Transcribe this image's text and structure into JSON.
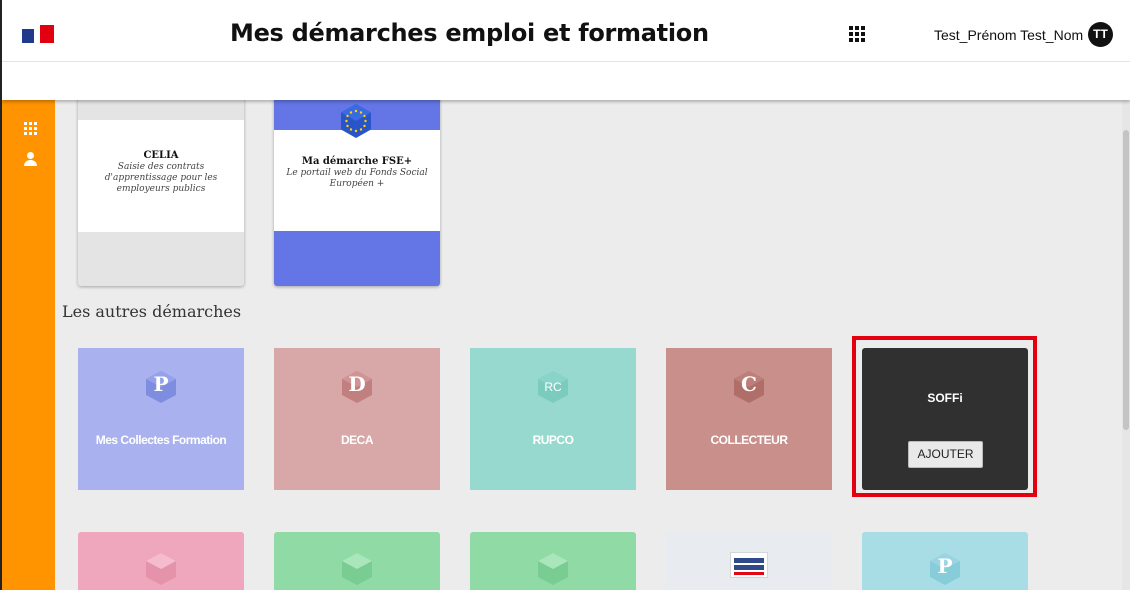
{
  "header": {
    "title": "Mes démarches emploi et formation",
    "user_name": "Test_Prénom Test_Nom",
    "avatar_initials": "TT",
    "logo_icon": "republique-francaise-logo",
    "apps_icon": "apps-grid-icon"
  },
  "sidebar": {
    "items": [
      {
        "icon": "apps-grid-icon"
      },
      {
        "icon": "user-icon"
      }
    ],
    "color": "#ff9300"
  },
  "favorites": [
    {
      "title": "CELIA",
      "subtitle": "Saisie des contrats d'apprentissage pour les employeurs publics"
    },
    {
      "title": "Ma démarche FSE+",
      "subtitle": "Le portail web du Fonds Social Européen +",
      "color": "#6476e6"
    }
  ],
  "other_section": {
    "title": "Les autres démarches",
    "tiles": [
      {
        "label": "Mes Collectes Formation",
        "letter": "P",
        "color": "#a9b2ee"
      },
      {
        "label": "DECA",
        "letter": "D",
        "color": "#d8a7a7"
      },
      {
        "label": "RUPCO",
        "letter": "RC",
        "color": "#98d9cf"
      },
      {
        "label": "COLLECTEUR",
        "letter": "C",
        "color": "#c98f8a"
      },
      {
        "label": "SOFFi",
        "button": "AJOUTER",
        "color": "#303030",
        "highlighted": true
      }
    ],
    "row2": [
      {
        "color": "#efa7bd"
      },
      {
        "color": "#8fdaa5"
      },
      {
        "color": "#8fdaa5"
      },
      {
        "color": "#e8ebf0",
        "icon": "mon-compte-formation-logo"
      },
      {
        "letter": "P",
        "color": "#a9dde6"
      }
    ]
  },
  "highlight_color": "#e3000f"
}
